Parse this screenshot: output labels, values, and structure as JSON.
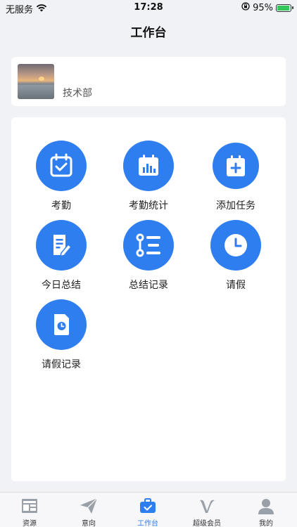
{
  "status_bar": {
    "carrier": "无服务",
    "time": "17:28",
    "battery": "95%"
  },
  "nav": {
    "title": "工作台"
  },
  "profile": {
    "name": "",
    "department": "技术部"
  },
  "grid": [
    {
      "label": "考勤",
      "icon": "calendar-check-icon"
    },
    {
      "label": "考勤统计",
      "icon": "calendar-chart-icon"
    },
    {
      "label": "添加任务",
      "icon": "calendar-add-icon"
    },
    {
      "label": "今日总结",
      "icon": "document-edit-icon"
    },
    {
      "label": "总结记录",
      "icon": "list-record-icon"
    },
    {
      "label": "请假",
      "icon": "clock-icon"
    },
    {
      "label": "请假记录",
      "icon": "file-clock-icon"
    }
  ],
  "tabs": [
    {
      "label": "资源",
      "icon": "resource-icon"
    },
    {
      "label": "意向",
      "icon": "paper-plane-icon"
    },
    {
      "label": "工作台",
      "icon": "briefcase-icon",
      "active": true
    },
    {
      "label": "超级会员",
      "icon": "vip-icon"
    },
    {
      "label": "我的",
      "icon": "user-icon"
    }
  ],
  "colors": {
    "accent": "#2f7ef0",
    "background": "#f1f2f6",
    "card": "#ffffff"
  }
}
